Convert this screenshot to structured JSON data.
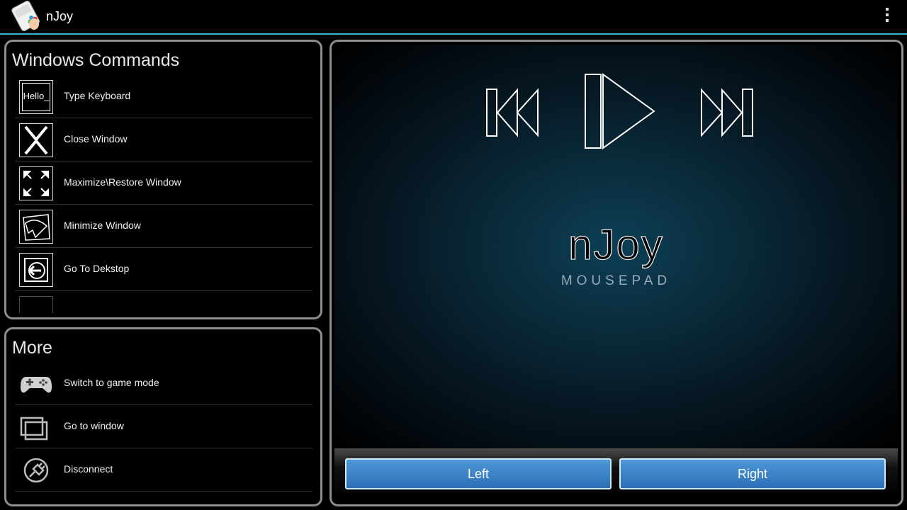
{
  "app": {
    "title": "nJoy"
  },
  "windows_commands": {
    "title": "Windows Commands",
    "items": [
      {
        "label": "Type Keyboard",
        "icon": "keyboard-hello-icon",
        "icon_text": "Hello_"
      },
      {
        "label": "Close Window",
        "icon": "close-window-icon"
      },
      {
        "label": "Maximize\\Restore Window",
        "icon": "maximize-icon"
      },
      {
        "label": "Minimize Window",
        "icon": "minimize-icon"
      },
      {
        "label": "Go To Dekstop",
        "icon": "desktop-arrow-icon"
      }
    ]
  },
  "more": {
    "title": "More",
    "items": [
      {
        "label": "Switch to game mode",
        "icon": "gamepad-icon"
      },
      {
        "label": "Go to window",
        "icon": "windows-stack-icon"
      },
      {
        "label": "Disconnect",
        "icon": "plug-icon"
      }
    ]
  },
  "mousepad": {
    "logo_title": "nJoy",
    "logo_subtitle": "MOUSEPAD",
    "media": [
      "previous-track-icon",
      "play-icon",
      "next-track-icon"
    ]
  },
  "buttons": {
    "left": "Left",
    "right": "Right"
  },
  "colors": {
    "accent": "#33b5e5",
    "button": "#3a82c8",
    "panel_border": "#8e8e8e"
  }
}
